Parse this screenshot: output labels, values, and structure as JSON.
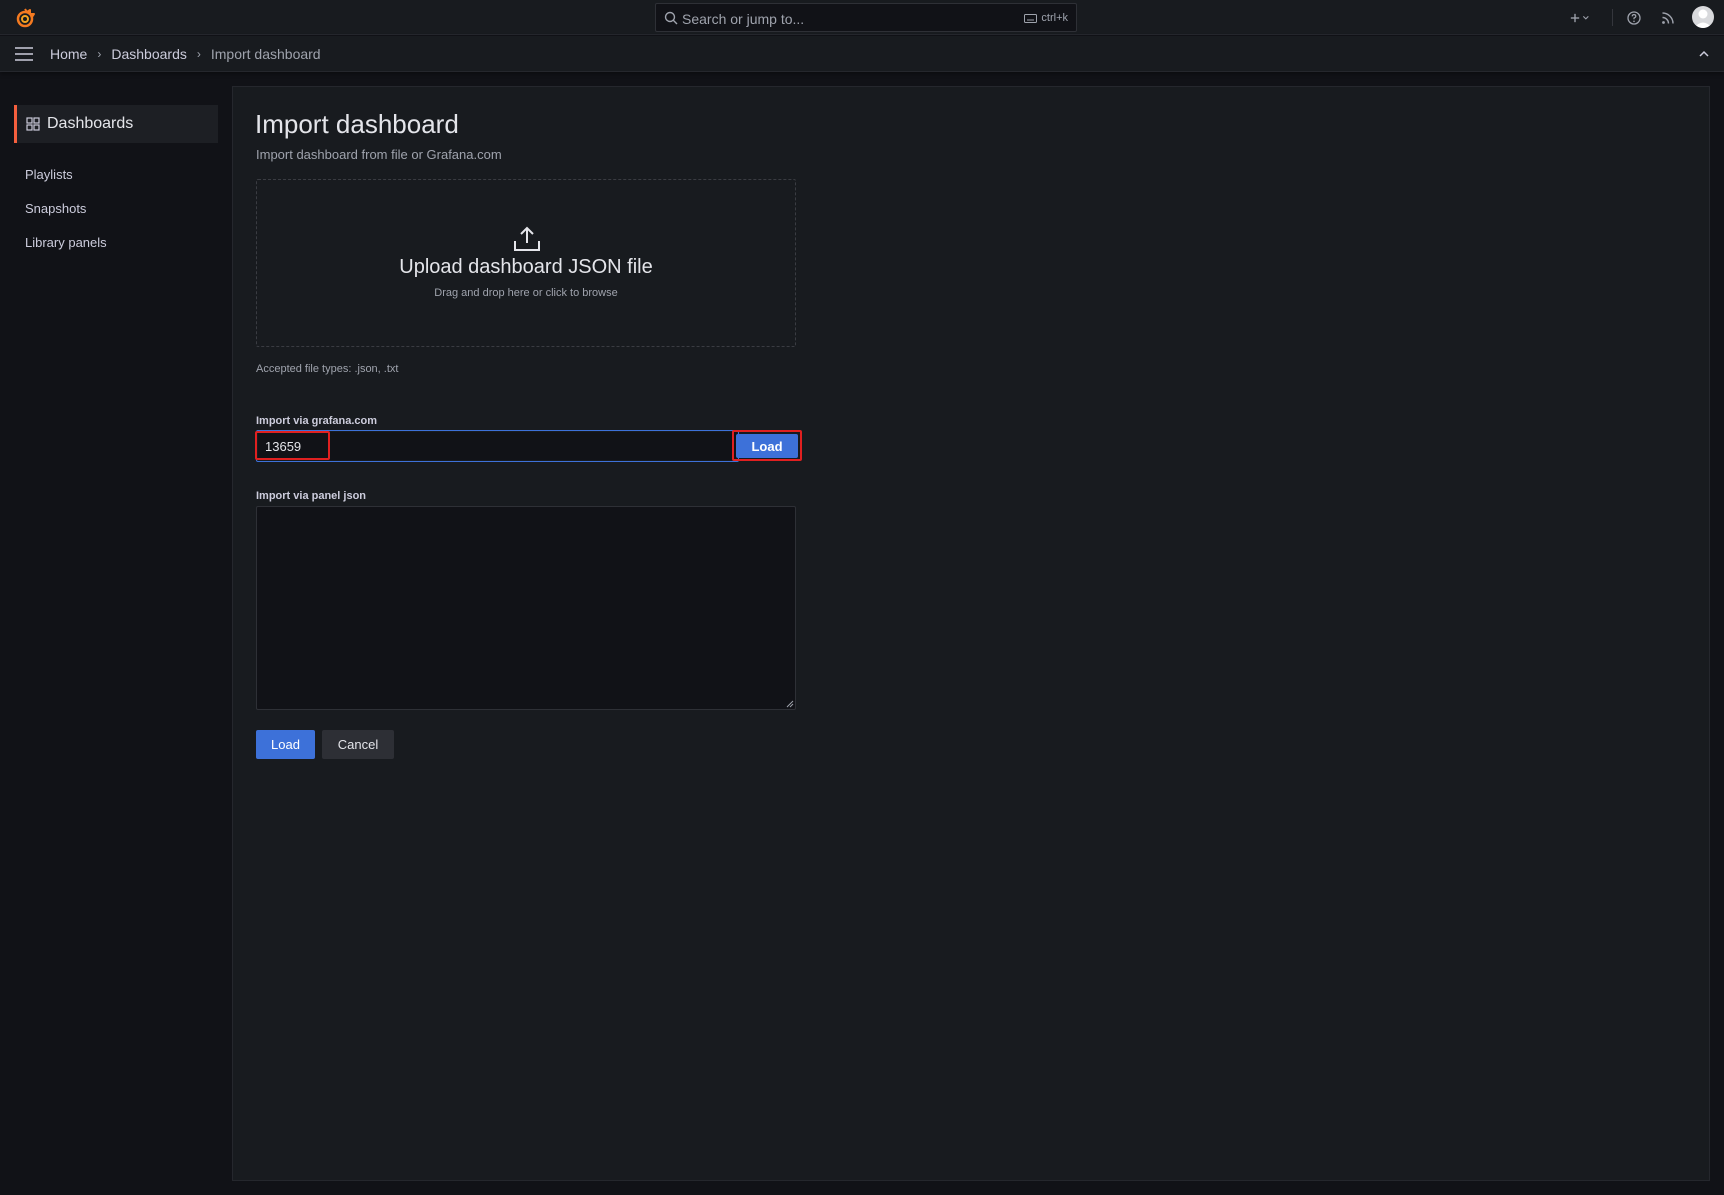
{
  "topbar": {
    "logo_icon": "grafana-logo-icon",
    "search": {
      "placeholder": "Search or jump to...",
      "shortcut": "ctrl+k"
    },
    "icons": [
      "plus-icon",
      "chevron-down-icon",
      "help-icon",
      "rss-icon",
      "avatar"
    ]
  },
  "breadcrumb": {
    "items": [
      "Home",
      "Dashboards",
      "Import dashboard"
    ]
  },
  "sidebar": {
    "active": {
      "label": "Dashboards",
      "icon": "apps-grid-icon"
    },
    "items": [
      {
        "label": "Playlists"
      },
      {
        "label": "Snapshots"
      },
      {
        "label": "Library panels"
      }
    ]
  },
  "main": {
    "title": "Import dashboard",
    "subtitle": "Import dashboard from file or Grafana.com",
    "upload": {
      "title": "Upload dashboard JSON file",
      "subtitle": "Drag and drop here or click to browse",
      "icon": "upload-icon"
    },
    "accepted_types": "Accepted file types: .json, .txt",
    "grafana_com": {
      "label": "Import via grafana.com",
      "value": "13659",
      "button": "Load"
    },
    "panel_json": {
      "label": "Import via panel json",
      "value": ""
    },
    "actions": {
      "load": "Load",
      "cancel": "Cancel"
    }
  },
  "colors": {
    "accent": "#3d71d9",
    "highlight": "#e02020",
    "active_border": "#f55f3e",
    "background": "#111217",
    "panel": "#181b1f"
  }
}
